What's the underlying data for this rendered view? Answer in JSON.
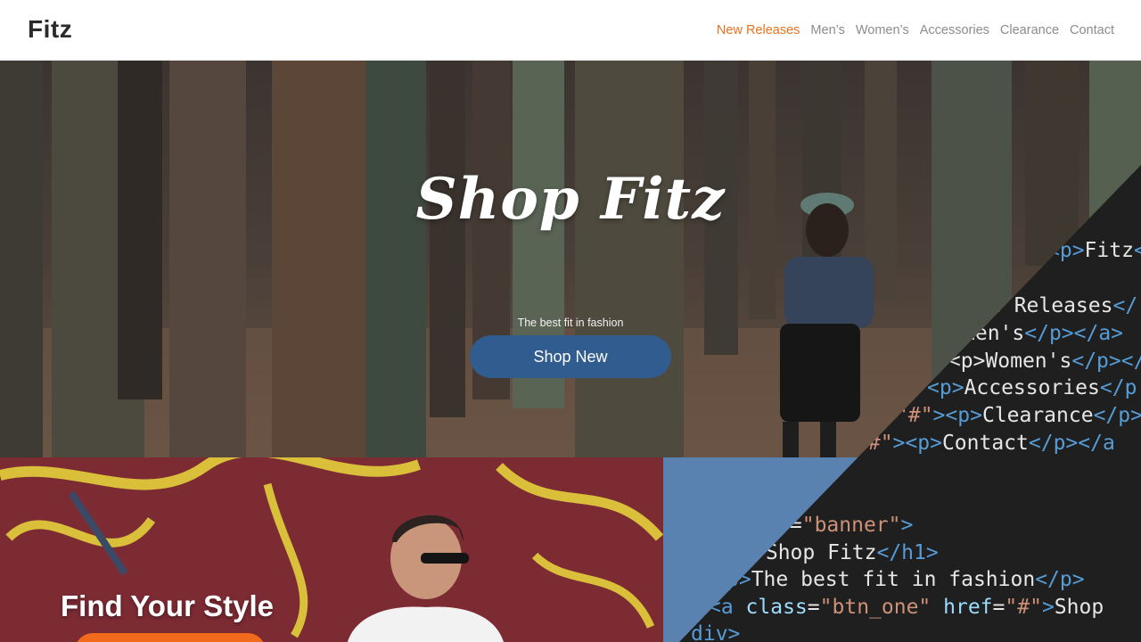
{
  "header": {
    "logo": "Fitz",
    "nav": [
      "New Releases",
      "Men’s",
      "Women’s",
      "Accessories",
      "Clearance",
      "Contact"
    ],
    "active_index": 0
  },
  "hero": {
    "title": "Shop Fitz",
    "tagline": "The best fit in fashion",
    "button_label": "Shop New"
  },
  "style_section": {
    "title": "Find Your Style"
  },
  "code_overlay": {
    "lines": [
      [
        [
          "tag",
          "<p>"
        ],
        [
          "txt",
          "Fitz"
        ],
        [
          "tag",
          "<"
        ]
      ],
      [
        [
          "txt",
          "w Releases"
        ],
        [
          "tag",
          "</"
        ]
      ],
      [
        [
          "txt",
          "Men's"
        ],
        [
          "tag",
          "</p></a>"
        ]
      ],
      [
        [
          "tag",
          ">"
        ],
        [
          "txt",
          "<p>"
        ],
        [
          "txt",
          "Women's"
        ],
        [
          "tag",
          "</p></a"
        ]
      ],
      [
        [
          "tag",
          "<p>"
        ],
        [
          "txt",
          "Accessories"
        ],
        [
          "tag",
          "</p"
        ]
      ],
      [
        [
          "str",
          "\"#\""
        ],
        [
          "tag",
          "><p>"
        ],
        [
          "txt",
          "Clearance"
        ],
        [
          "tag",
          "</p>"
        ]
      ],
      [
        [
          "str",
          "\"#\""
        ],
        [
          "tag",
          "><p>"
        ],
        [
          "txt",
          "Contact"
        ],
        [
          "tag",
          "</p></a"
        ]
      ],
      [
        [
          "txt",
          ""
        ]
      ],
      [
        [
          "attr",
          "s"
        ],
        [
          "txt",
          "="
        ],
        [
          "str",
          "\"banner\""
        ],
        [
          "tag",
          ">"
        ]
      ],
      [
        [
          "tag",
          ">"
        ],
        [
          "txt",
          "Shop Fitz"
        ],
        [
          "tag",
          "</h1>"
        ]
      ],
      [
        [
          "tag",
          "p>"
        ],
        [
          "txt",
          "The best fit in fashion"
        ],
        [
          "tag",
          "</p>"
        ]
      ],
      [
        [
          "tag",
          "<a "
        ],
        [
          "attr",
          "class"
        ],
        [
          "txt",
          "="
        ],
        [
          "str",
          "\"btn_one\""
        ],
        [
          "txt",
          " "
        ],
        [
          "attr",
          "href"
        ],
        [
          "txt",
          "="
        ],
        [
          "str",
          "\"#\""
        ],
        [
          "tag",
          ">"
        ],
        [
          "txt",
          "Shop"
        ]
      ],
      [
        [
          "tag",
          "div>"
        ]
      ]
    ]
  },
  "colors": {
    "accent": "#e8731f",
    "hero_button": "#305c8f",
    "style_button": "#f26a1b",
    "blue_panel": "#5a82b0",
    "code_background": "#1f1f1f"
  }
}
